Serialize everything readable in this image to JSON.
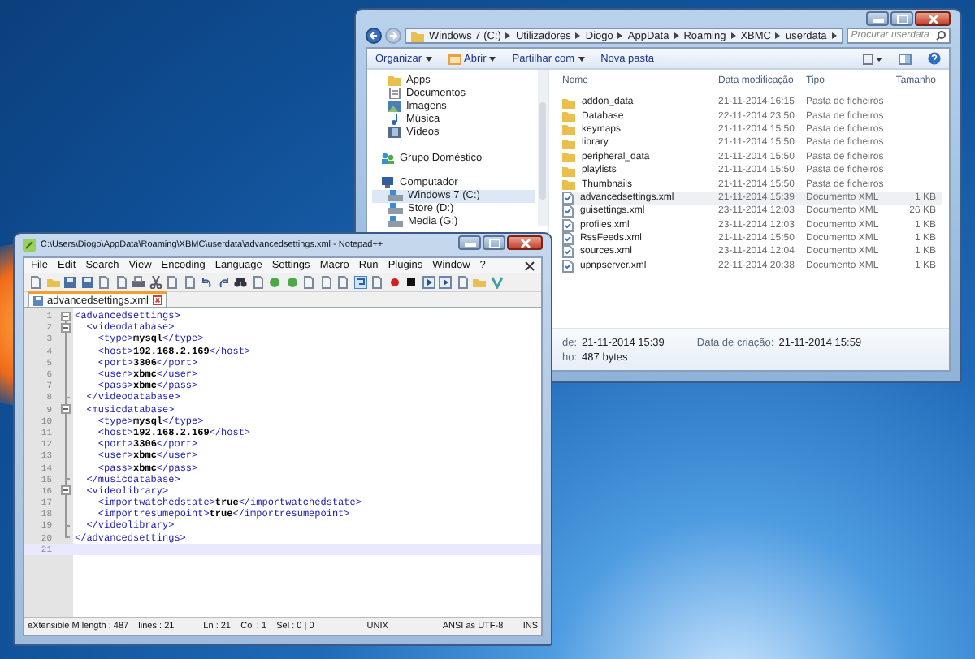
{
  "explorer": {
    "breadcrumb": [
      "Windows 7 (C:)",
      "Utilizadores",
      "Diogo",
      "AppData",
      "Roaming",
      "XBMC",
      "userdata"
    ],
    "search": {
      "placeholder": "Procurar userdata"
    },
    "toolbar": [
      {
        "label": "Organizar",
        "kind": "menu"
      },
      {
        "label": "Abrir",
        "kind": "open"
      },
      {
        "label": "Partilhar com",
        "kind": "menu"
      },
      {
        "label": "Nova pasta",
        "kind": "plain"
      }
    ],
    "nav_top": [
      {
        "label": "Apps",
        "kind": "folder",
        "selected": false
      },
      {
        "label": "Documentos",
        "kind": "document",
        "selected": false
      },
      {
        "label": "Imagens",
        "kind": "picture",
        "selected": false
      },
      {
        "label": "Música",
        "kind": "music",
        "selected": false
      },
      {
        "label": "Vídeos",
        "kind": "video",
        "selected": false
      }
    ],
    "nav_tree": [
      {
        "label": "Grupo Doméstico",
        "kind": "homegroup",
        "selected": false
      },
      {
        "label": "Computador",
        "kind": "computer",
        "selected": false,
        "children": [
          {
            "label": "Windows 7 (C:)",
            "kind": "drive",
            "selected": true
          },
          {
            "label": "Store (D:)",
            "kind": "drive",
            "selected": false
          },
          {
            "label": "Media (G:)",
            "kind": "drive",
            "selected": false
          }
        ]
      }
    ],
    "columns": [
      "Nome",
      "Data modificação",
      "Tipo",
      "Tamanho"
    ],
    "files": [
      {
        "name": "addon_data",
        "date": "21-11-2014 16:15",
        "type": "Pasta de ficheiros",
        "kind": "folder",
        "selected": false
      },
      {
        "name": "Database",
        "date": "22-11-2014 23:50",
        "type": "Pasta de ficheiros",
        "kind": "folder",
        "selected": false
      },
      {
        "name": "keymaps",
        "date": "21-11-2014 15:50",
        "type": "Pasta de ficheiros",
        "kind": "folder",
        "selected": false
      },
      {
        "name": "library",
        "date": "21-11-2014 15:50",
        "type": "Pasta de ficheiros",
        "kind": "folder",
        "selected": false
      },
      {
        "name": "peripheral_data",
        "date": "21-11-2014 15:50",
        "type": "Pasta de ficheiros",
        "kind": "folder",
        "selected": false
      },
      {
        "name": "playlists",
        "date": "21-11-2014 15:50",
        "type": "Pasta de ficheiros",
        "kind": "folder",
        "selected": false
      },
      {
        "name": "Thumbnails",
        "date": "21-11-2014 15:50",
        "type": "Pasta de ficheiros",
        "kind": "folder",
        "selected": false
      },
      {
        "name": "advancedsettings.xml",
        "date": "21-11-2014 15:39",
        "type": "Documento XML",
        "size": "1 KB",
        "kind": "xml",
        "selected": true
      },
      {
        "name": "guisettings.xml",
        "date": "23-11-2014 12:03",
        "type": "Documento XML",
        "size": "26 KB",
        "kind": "xml",
        "selected": false
      },
      {
        "name": "profiles.xml",
        "date": "23-11-2014 12:03",
        "type": "Documento XML",
        "size": "1 KB",
        "kind": "xml",
        "selected": false
      },
      {
        "name": "RssFeeds.xml",
        "date": "21-11-2014 15:50",
        "type": "Documento XML",
        "size": "1 KB",
        "kind": "xml",
        "selected": false
      },
      {
        "name": "sources.xml",
        "date": "23-11-2014 12:04",
        "type": "Documento XML",
        "size": "1 KB",
        "kind": "xml",
        "selected": false
      },
      {
        "name": "upnpserver.xml",
        "date": "22-11-2014 20:38",
        "type": "Documento XML",
        "size": "1 KB",
        "kind": "xml",
        "selected": false
      }
    ],
    "details": [
      {
        "label": "de:",
        "value": "21-11-2014 15:39"
      },
      {
        "label": "ho:",
        "value": "487 bytes"
      }
    ],
    "created": {
      "label": "Data de criação:",
      "value": "21-11-2014 15:59"
    }
  },
  "notepad": {
    "title": "C:\\Users\\Diogo\\AppData\\Roaming\\XBMC\\userdata\\advancedsettings.xml - Notepad++",
    "menu": [
      "File",
      "Edit",
      "Search",
      "View",
      "Encoding",
      "Language",
      "Settings",
      "Macro",
      "Run",
      "Plugins",
      "Window",
      "?"
    ],
    "tabs": [
      {
        "label": "advancedsettings.xml",
        "selected": true
      }
    ],
    "lines": [
      {
        "number": "1",
        "text": "<advancedsettings>",
        "kind": "open",
        "current": false
      },
      {
        "number": "2",
        "text": "  <videodatabase>",
        "kind": "open",
        "current": false
      },
      {
        "number": "3",
        "text": "    <type>mysql</type>",
        "kind": "line",
        "current": false
      },
      {
        "number": "4",
        "text": "    <host>192.168.2.169</host>",
        "kind": "line",
        "current": false
      },
      {
        "number": "5",
        "text": "    <port>3306</port>",
        "kind": "line",
        "current": false
      },
      {
        "number": "6",
        "text": "    <user>xbmc</user>",
        "kind": "line",
        "current": false
      },
      {
        "number": "7",
        "text": "    <pass>xbmc</pass>",
        "kind": "line",
        "current": false
      },
      {
        "number": "8",
        "text": "  </videodatabase>",
        "kind": "end",
        "current": false
      },
      {
        "number": "9",
        "text": "  <musicdatabase>",
        "kind": "open",
        "current": false
      },
      {
        "number": "10",
        "text": "    <type>mysql</type>",
        "kind": "line",
        "current": false
      },
      {
        "number": "11",
        "text": "    <host>192.168.2.169</host>",
        "kind": "line",
        "current": false
      },
      {
        "number": "12",
        "text": "    <port>3306</port>",
        "kind": "line",
        "current": false
      },
      {
        "number": "13",
        "text": "    <user>xbmc</user>",
        "kind": "line",
        "current": false
      },
      {
        "number": "14",
        "text": "    <pass>xbmc</pass>",
        "kind": "line",
        "current": false
      },
      {
        "number": "15",
        "text": "  </musicdatabase>",
        "kind": "end",
        "current": false
      },
      {
        "number": "16",
        "text": "  <videolibrary>",
        "kind": "open",
        "current": false
      },
      {
        "number": "17",
        "text": "    <importwatchedstate>true</importwatchedstate>",
        "kind": "line",
        "current": false
      },
      {
        "number": "18",
        "text": "    <importresumepoint>true</importresumepoint>",
        "kind": "line",
        "current": false
      },
      {
        "number": "19",
        "text": "  </videolibrary>",
        "kind": "end",
        "current": false
      },
      {
        "number": "20",
        "text": "</advancedsettings>",
        "kind": "last",
        "current": false
      },
      {
        "number": "21",
        "kind": "plain",
        "current": true
      }
    ],
    "status": [
      "eXtensible M length : 487    lines : 21",
      "Ln : 21    Col : 1    Sel : 0 | 0",
      "UNIX",
      "ANSI as UTF-8",
      "INS"
    ]
  }
}
